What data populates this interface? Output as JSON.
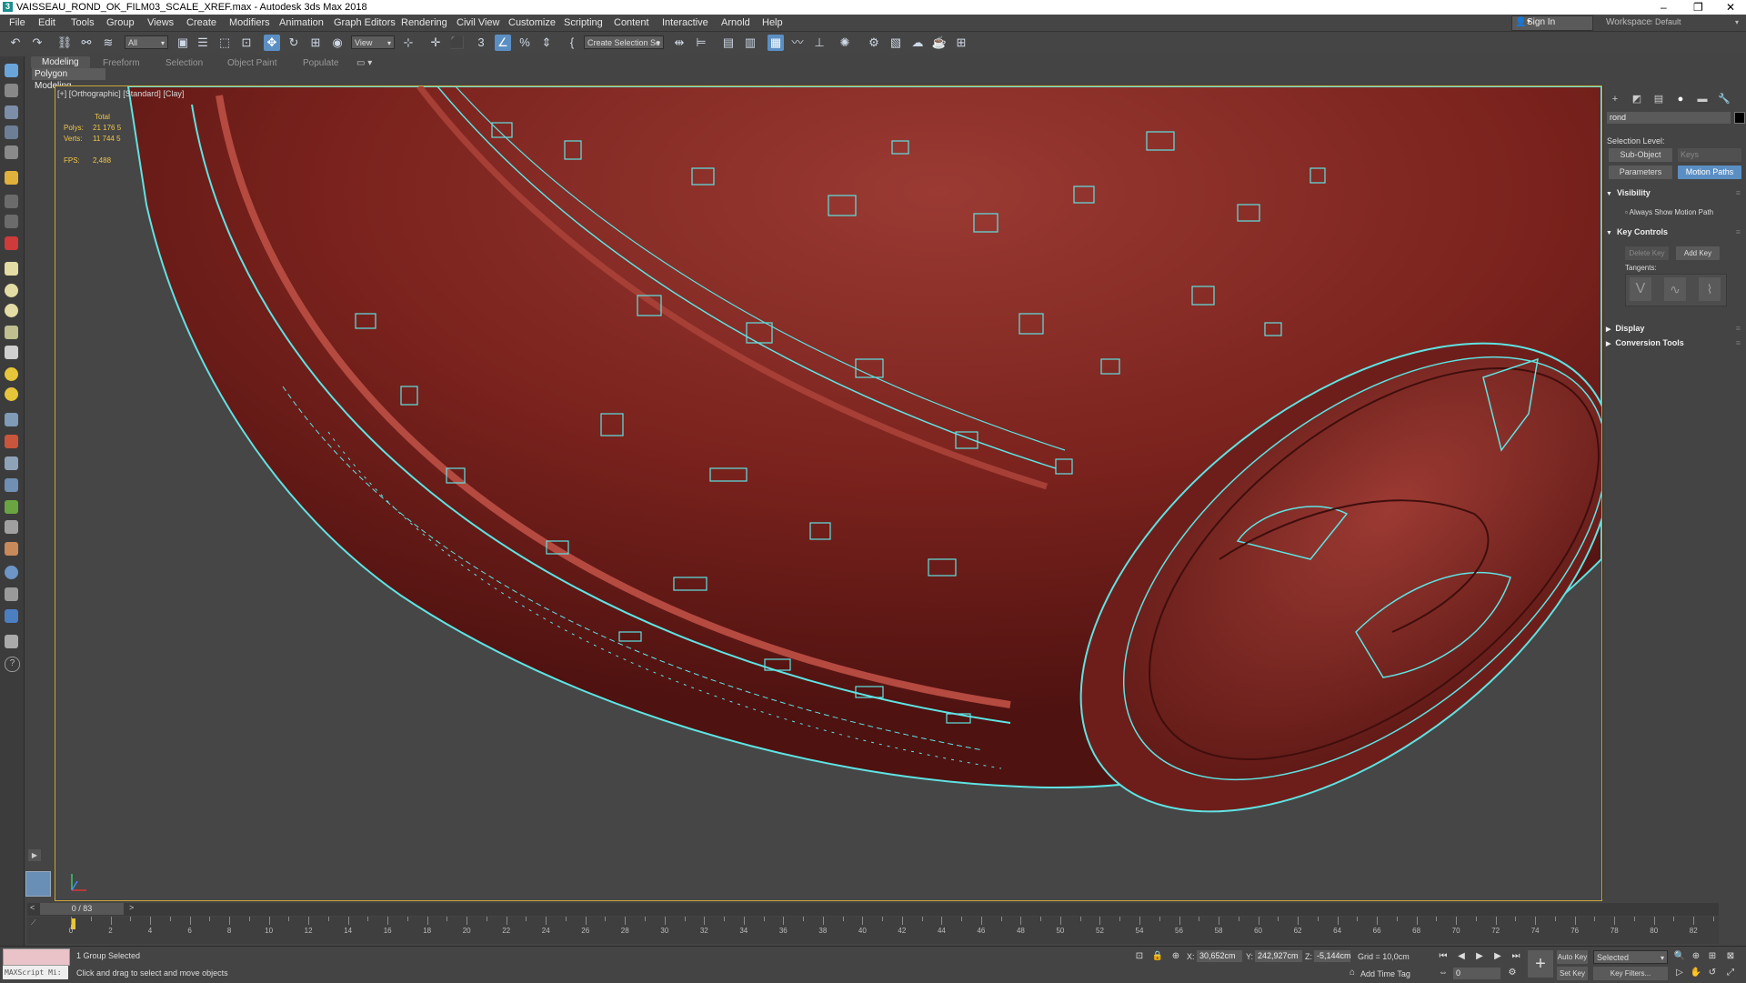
{
  "window": {
    "title": "VAISSEAU_ROND_OK_FILM03_SCALE_XREF.max - Autodesk 3ds Max 2018",
    "logo_letter": "3",
    "controls": [
      "–",
      "❐",
      "✕"
    ]
  },
  "menubar": {
    "items": [
      "File",
      "Edit",
      "Tools",
      "Group",
      "Views",
      "Create",
      "Modifiers",
      "Animation",
      "Graph Editors",
      "Rendering",
      "Civil View",
      "Customize",
      "Scripting",
      "Content",
      "Interactive",
      "Arnold",
      "Help"
    ],
    "sign_in": "Sign In",
    "workspaces_label": "Workspaces:",
    "workspaces_value": "Default"
  },
  "toolbar": {
    "selection_filter": "All",
    "ref_coord": "View",
    "named_selection": "Create Selection Se"
  },
  "ribbon": {
    "tabs": [
      "Modeling",
      "Freeform",
      "Selection",
      "Object Paint",
      "Populate"
    ],
    "active_tab": "Modeling",
    "panel": "Polygon Modeling"
  },
  "viewport": {
    "label": "[+] [Orthographic] [Standard] [Clay]",
    "stats_header": "Total",
    "polys_label": "Polys:",
    "polys_value": "21 176 5",
    "verts_label": "Verts:",
    "verts_value": "11 744 5",
    "fps_label": "FPS:",
    "fps_value": "2,488",
    "colors": {
      "object": "#8a2a24",
      "wire": "#5fe3e3",
      "background": "#464646",
      "border": "#c8a53a"
    }
  },
  "command_panel": {
    "name_field": "rond",
    "selection_level_label": "Selection Level:",
    "sub_object": "Sub-Object",
    "keys": "Keys",
    "parameters": "Parameters",
    "motion_paths": "Motion Paths",
    "rollouts": {
      "visibility": "Visibility",
      "always_show": "Always Show Motion Path",
      "key_controls": "Key Controls",
      "delete_key": "Delete Key",
      "add_key": "Add Key",
      "tangents": "Tangents:",
      "display": "Display",
      "conversion_tools": "Conversion Tools"
    }
  },
  "timeline": {
    "frame_display": "0 / 83",
    "prev": "<",
    "next": ">",
    "ticks": [
      "0",
      "2",
      "4",
      "6",
      "8",
      "10",
      "12",
      "14",
      "16",
      "18",
      "20",
      "22",
      "24",
      "26",
      "28",
      "30",
      "32",
      "34",
      "36",
      "38",
      "40",
      "42",
      "44",
      "46",
      "48",
      "50",
      "52",
      "54",
      "56",
      "58",
      "60",
      "62",
      "64",
      "66",
      "68",
      "70",
      "72",
      "74",
      "76",
      "78",
      "80",
      "82"
    ]
  },
  "statusbar": {
    "listener": "MAXScript Mi:",
    "selection_info": "1 Group Selected",
    "prompt": "Click and drag to select and move objects",
    "x_label": "X:",
    "x_value": "30,652cm",
    "y_label": "Y:",
    "y_value": "242,927cm",
    "z_label": "Z:",
    "z_value": "-5,144cm",
    "grid": "Grid = 10,0cm",
    "add_time_tag": "Add Time Tag",
    "auto_key": "Auto Key",
    "set_key": "Set Key",
    "selected": "Selected",
    "key_filters": "Key Filters...",
    "current_frame": "0"
  }
}
